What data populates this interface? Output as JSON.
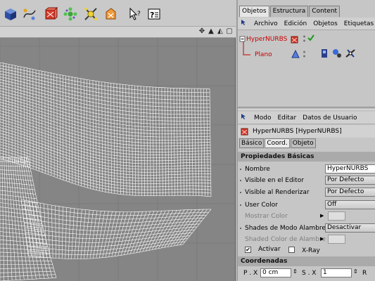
{
  "toolbar": {
    "icons": [
      "cube-primitive-icon",
      "spline-pen-icon",
      "nurbs-generator-icon",
      "array-object-icon",
      "deformer-icon",
      "scene-object-icon",
      "help-cursor-icon",
      "render-settings-icon"
    ]
  },
  "viewport": {
    "nav_icons": [
      "move-icon",
      "up-arrow-icon",
      "zoom-icon",
      "maximize-icon"
    ]
  },
  "panel": {
    "tabs": [
      "Objetos",
      "Estructura",
      "Content"
    ],
    "object_menu": [
      "Archivo",
      "Edición",
      "Objetos",
      "Etiquetas"
    ],
    "objects": [
      {
        "name": "HyperNURBS",
        "color": "#c80000"
      },
      {
        "name": "Plano",
        "color": "#c80000"
      }
    ],
    "attr_menu": [
      "Modo",
      "Editar",
      "Datos de Usuario"
    ],
    "selected_object": "HyperNURBS [HyperNURBS]",
    "attr_tabs": [
      "Básico",
      "Coord.",
      "Objeto"
    ],
    "section_basic": "Propiedades Básicas",
    "props": {
      "nombre_label": "Nombre",
      "nombre_value": "HyperNURBS",
      "visible_editor_label": "Visible en el Editor",
      "visible_editor_value": "Por Defecto",
      "visible_render_label": "Visible al Renderizar",
      "visible_render_value": "Por Defecto",
      "user_color_label": "User Color",
      "user_color_value": "Off",
      "mostrar_color_label": "Mostrar Color",
      "shades_label": "Shades de Modo Alambre",
      "shades_value": "Desactivar",
      "shaded_color_label": "Shaded Color de Alambre",
      "activar_label": "Activar",
      "xray_label": "X-Ray"
    },
    "section_coords": "Coordenadas",
    "coords": {
      "px_label": "P . X",
      "px_value": "0 cm",
      "sx_label": "S . X",
      "sx_value": "1",
      "r_label": "R"
    }
  },
  "colors": {
    "accent_red": "#c80000",
    "viewport_bg": "#858585",
    "panel_bg": "#c6c6c6"
  }
}
